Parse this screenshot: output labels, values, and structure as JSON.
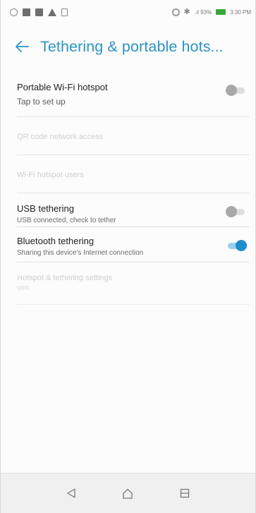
{
  "status_bar": {
    "left_icons": [
      "sync-icon",
      "image-icon",
      "image-icon",
      "warning-icon",
      "clipboard-icon"
    ],
    "right_icons": [
      "hotspot-icon",
      "bluetooth-icon",
      "signal-icon",
      "battery-icon"
    ],
    "signal_text": ".ıl 93%",
    "time": "3:30 PM"
  },
  "header": {
    "back_icon": "back-arrow-icon",
    "title": "Tethering & portable hots..."
  },
  "settings": {
    "wifi_hotspot": {
      "title": "Portable Wi-Fi hotspot",
      "subtitle": "Tap to set up",
      "enabled": false
    },
    "qr_code": {
      "title": "QR code network access"
    },
    "hotspot_users": {
      "title": "Wi-Fi hotspot users"
    },
    "usb_tethering": {
      "title": "USB tethering",
      "subtitle": "USB connected, check to tether",
      "enabled": false
    },
    "bluetooth_tethering": {
      "title": "Bluetooth tethering",
      "subtitle": "Sharing this device's Internet connection",
      "enabled": true
    },
    "hotspot_settings": {
      "title": "Hotspot & tethering settings",
      "subtitle": "WPA"
    }
  },
  "colors": {
    "accent": "#2a93c4",
    "toggle_on": "#1e8ccd",
    "toggle_off": "#a8a8a8",
    "battery": "#3aa53a"
  },
  "nav_bar": {
    "buttons": [
      "back-icon",
      "home-icon",
      "recents-icon"
    ]
  }
}
